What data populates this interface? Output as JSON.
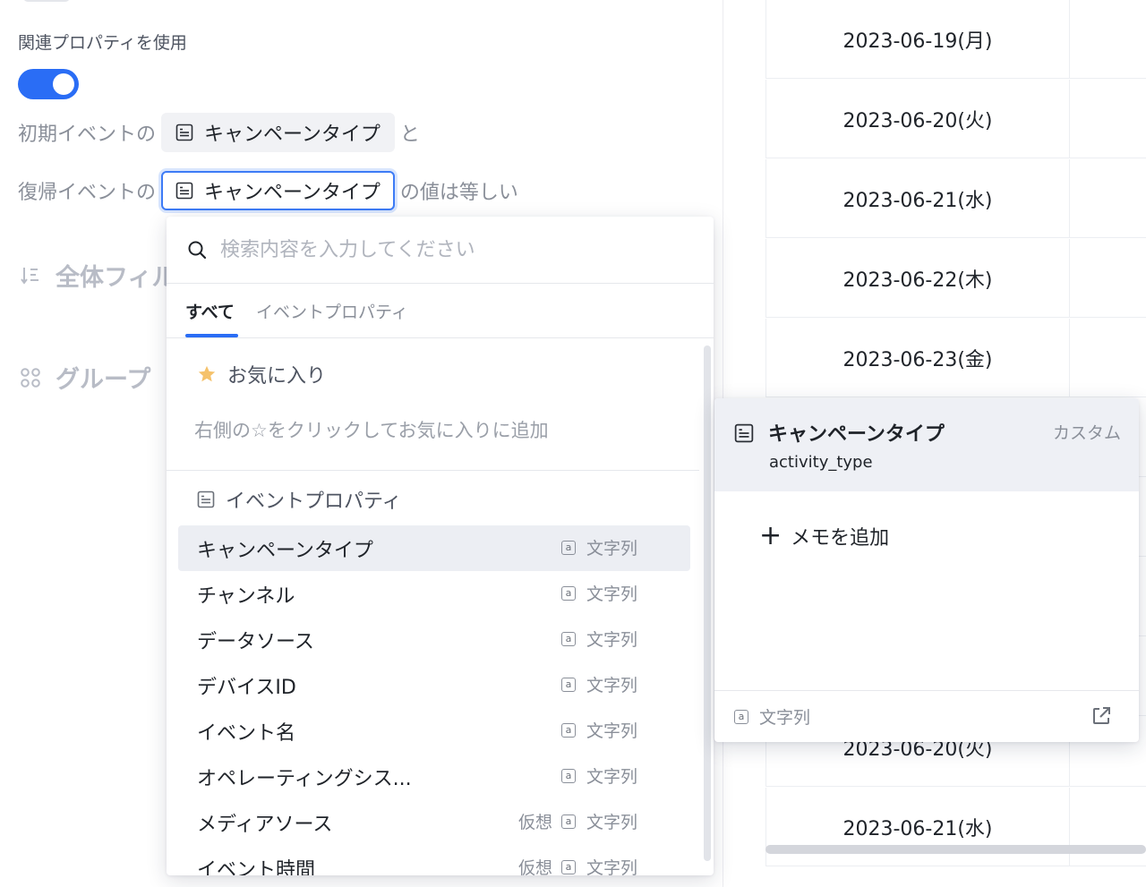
{
  "settings": {
    "related_property_label": "関連プロパティを使用",
    "toggle_on": true,
    "row1_prefix": "初期イベントの",
    "row1_chip": "キャンペーンタイプ",
    "row1_suffix": "と",
    "row2_prefix": "復帰イベントの",
    "row2_chip": "キャンペーンタイプ",
    "row2_suffix": "の値は等しい",
    "global_filter_label": "全体フィル",
    "group_label": "グループ"
  },
  "table": {
    "rows": [
      "2023-06-19(月)",
      "2023-06-20(火)",
      "2023-06-21(水)",
      "2023-06-22(木)",
      "2023-06-23(金)",
      "",
      "",
      "",
      "",
      "2023-06-20(火)",
      "2023-06-21(水)"
    ]
  },
  "dropdown": {
    "search_placeholder": "検索内容を入力してください",
    "tabs": [
      "すべて",
      "イベントプロパティ"
    ],
    "active_tab": "すべて",
    "favorites_title": "お気に入り",
    "favorites_hint": "右側の☆をクリックしてお気に入りに追加",
    "group_title": "イベントプロパティ",
    "items": [
      {
        "name": "キャンペーンタイプ",
        "virtual": "",
        "type": "文字列"
      },
      {
        "name": "チャンネル",
        "virtual": "",
        "type": "文字列"
      },
      {
        "name": "データソース",
        "virtual": "",
        "type": "文字列"
      },
      {
        "name": "デバイスID",
        "virtual": "",
        "type": "文字列"
      },
      {
        "name": "イベント名",
        "virtual": "",
        "type": "文字列"
      },
      {
        "name": "オペレーティングシス...",
        "virtual": "",
        "type": "文字列"
      },
      {
        "name": "メディアソース",
        "virtual": "仮想",
        "type": "文字列"
      },
      {
        "name": "イベント時間",
        "virtual": "仮想",
        "type": "文字列"
      }
    ],
    "type_icon_glyph": "a",
    "highlighted_index": 0
  },
  "detail": {
    "title": "キャンペーンタイプ",
    "subtitle": "activity_type",
    "badge": "カスタム",
    "add_memo": "メモを追加",
    "add_memo_icon": "+",
    "footer_type": "文字列"
  },
  "colors": {
    "accent": "#2a6df5",
    "favorite_star": "#f5c26b"
  },
  "icons": {
    "search": "search-icon",
    "property": "property-list-icon",
    "star": "star-icon",
    "filter": "filter-sort-icon",
    "group": "group-grid-icon",
    "external": "external-link-icon"
  }
}
